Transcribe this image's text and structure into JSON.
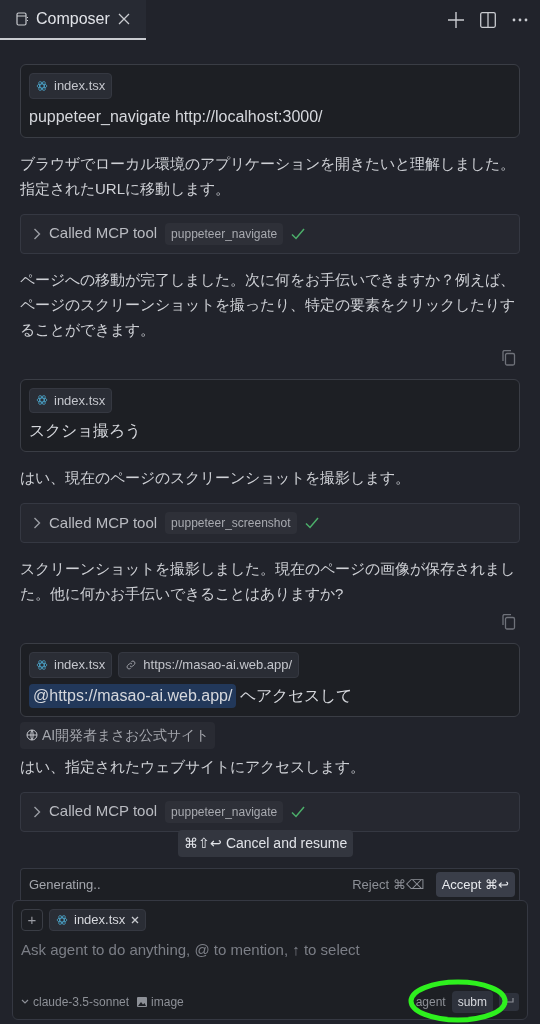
{
  "tab": {
    "title": "Composer"
  },
  "messages": [
    {
      "kind": "user",
      "chips": [
        {
          "kind": "file",
          "label": "index.tsx"
        }
      ],
      "parts": [
        {
          "text": "puppeteer_navigate http://localhost:3000/",
          "mention": false
        }
      ]
    },
    {
      "kind": "assistant",
      "text": "ブラウザでローカル環境のアプリケーションを開きたいと理解しました。指定されたURLに移動します。",
      "copy": false
    },
    {
      "kind": "tool",
      "label": "Called MCP tool",
      "tool": "puppeteer_navigate",
      "done": true
    },
    {
      "kind": "assistant",
      "text": "ページへの移動が完了しました。次に何をお手伝いできますか？例えば、ページのスクリーンショットを撮ったり、特定の要素をクリックしたりすることができます。",
      "copy": true
    },
    {
      "kind": "user",
      "chips": [
        {
          "kind": "file",
          "label": "index.tsx"
        }
      ],
      "parts": [
        {
          "text": "スクショ撮ろう",
          "mention": false
        }
      ]
    },
    {
      "kind": "assistant",
      "text": "はい、現在のページのスクリーンショットを撮影します。",
      "copy": false
    },
    {
      "kind": "tool",
      "label": "Called MCP tool",
      "tool": "puppeteer_screenshot",
      "done": true
    },
    {
      "kind": "assistant",
      "text": "スクリーンショットを撮影しました。現在のページの画像が保存されました。他に何かお手伝いできることはありますか?",
      "copy": true
    },
    {
      "kind": "user",
      "chips": [
        {
          "kind": "file",
          "label": "index.tsx"
        },
        {
          "kind": "link",
          "label": "https://masao-ai.web.app/"
        }
      ],
      "parts": [
        {
          "text": "@https://masao-ai.web.app/",
          "mention": true
        },
        {
          "text": "ヘアクセスして",
          "mention": false
        }
      ]
    },
    {
      "kind": "source",
      "text": "AI開発者まさお公式サイト"
    },
    {
      "kind": "assistant",
      "text": "はい、指定されたウェブサイトにアクセスします。",
      "copy": false
    },
    {
      "kind": "tool",
      "label": "Called MCP tool",
      "tool": "puppeteer_navigate",
      "done": true
    }
  ],
  "tooltip": "⌘⇧↩ Cancel and resume",
  "generating": {
    "status": "Generating..",
    "reject": "Reject ⌘⌫",
    "accept": "Accept ⌘↩"
  },
  "composer": {
    "add": "+",
    "chips": [
      {
        "label": "index.tsx"
      }
    ],
    "placeholder": "Ask agent to do anything, @ to mention, ↑ to select",
    "model": "claude-3.5-sonnet",
    "image": "image",
    "mode": "agent",
    "submit": "subm"
  }
}
